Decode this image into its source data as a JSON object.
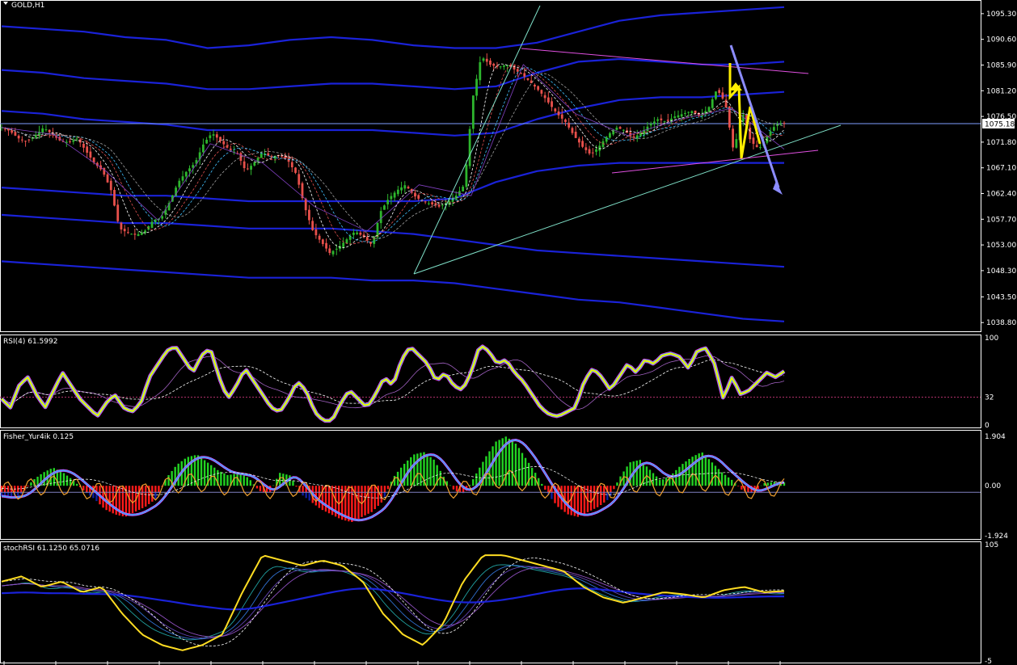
{
  "symbol": "GOLD,H1",
  "colors": {
    "background": "#000000",
    "candle_up": "#2db52d",
    "candle_down": "#e8504b",
    "bands": "#1a22d8",
    "trendline": "#7fe0c8",
    "resistance": "#e050e0",
    "current_price_line": "#7fa0ff",
    "arrow_yellow": "#ffee00",
    "arrow_blue": "#8c8cff",
    "rsi_yellow": "#ffee00",
    "rsi_magenta": "#ff2bd6",
    "rsi_cyan": "#20c8ff",
    "fisher_green": "#22d322",
    "fisher_red": "#ff1a1a",
    "fisher_navy": "#0f1fa0",
    "fisher_orange": "#f0a030",
    "stoch_yellow": "#ffdd22"
  },
  "chart_data": [
    {
      "type": "candlestick",
      "panel": "price",
      "title": "GOLD,H1",
      "current_price": "1075.18",
      "ylim": [
        1037.5,
        1097.5
      ],
      "y_tick_labels": [
        "1095.30",
        "1090.60",
        "1085.90",
        "1081.20",
        "1076.50",
        "1071.80",
        "1067.10",
        "1062.40",
        "1057.70",
        "1053.00",
        "1048.30",
        "1043.50",
        "1038.80"
      ],
      "y_ticks": [
        1095.3,
        1090.6,
        1085.9,
        1081.2,
        1076.5,
        1071.8,
        1067.1,
        1062.4,
        1057.7,
        1053.0,
        1048.3,
        1043.5,
        1038.8
      ],
      "close_path": [
        1074.5,
        1073.8,
        1072.5,
        1071.9,
        1073.0,
        1074.5,
        1073.2,
        1072.0,
        1071.8,
        1072.5,
        1070.2,
        1068.0,
        1066.5,
        1063.0,
        1056.0,
        1055.2,
        1054.8,
        1055.5,
        1057.5,
        1058.0,
        1061.0,
        1064.5,
        1066.5,
        1068.0,
        1071.5,
        1073.5,
        1072.0,
        1070.5,
        1069.8,
        1066.5,
        1068.0,
        1070.0,
        1069.0,
        1069.5,
        1068.5,
        1066.0,
        1060.0,
        1055.5,
        1053.5,
        1051.5,
        1052.5,
        1054.0,
        1055.5,
        1054.5,
        1053.0,
        1059.0,
        1061.5,
        1063.0,
        1064.0,
        1062.0,
        1061.0,
        1060.5,
        1060.0,
        1060.8,
        1062.0,
        1064.0,
        1080.0,
        1087.5,
        1086.0,
        1085.5,
        1086.0,
        1085.0,
        1084.0,
        1082.5,
        1081.0,
        1079.0,
        1077.0,
        1075.5,
        1073.0,
        1071.0,
        1069.5,
        1071.0,
        1073.0,
        1074.5,
        1074.0,
        1072.5,
        1073.5,
        1075.0,
        1076.0,
        1075.5,
        1076.5,
        1077.0,
        1077.5,
        1076.5,
        1078.0,
        1081.5,
        1079.0,
        1070.0,
        1077.5,
        1072.0,
        1070.5,
        1073.0,
        1075.0,
        1075.2
      ],
      "bands_upper": [
        [
          1093.0,
          1092.5,
          1092.0,
          1091.0,
          1090.5,
          1089.0,
          1089.5,
          1090.5,
          1091.0,
          1090.5,
          1089.5,
          1089.0,
          1089.0,
          1090.0,
          1092.0,
          1094.0,
          1095.0,
          1095.5,
          1096.0,
          1096.5
        ],
        [
          1085.0,
          1084.5,
          1083.5,
          1083.0,
          1082.5,
          1081.5,
          1081.5,
          1082.0,
          1082.5,
          1082.5,
          1082.0,
          1081.5,
          1082.0,
          1084.5,
          1086.5,
          1087.0,
          1086.5,
          1086.0,
          1086.0,
          1086.5
        ],
        [
          1077.5,
          1077.0,
          1076.0,
          1075.5,
          1075.0,
          1074.0,
          1074.0,
          1074.0,
          1074.0,
          1074.0,
          1073.5,
          1073.0,
          1073.5,
          1076.0,
          1078.0,
          1079.5,
          1080.0,
          1080.0,
          1080.5,
          1081.0
        ]
      ],
      "bands_lower": [
        [
          1063.5,
          1063.0,
          1062.5,
          1062.0,
          1062.0,
          1061.5,
          1061.0,
          1061.0,
          1061.0,
          1061.0,
          1061.0,
          1061.5,
          1064.5,
          1066.5,
          1067.5,
          1068.0,
          1068.0,
          1068.0,
          1068.0,
          1068.0
        ],
        [
          1058.5,
          1058.0,
          1057.5,
          1057.0,
          1057.0,
          1056.5,
          1056.0,
          1056.0,
          1056.0,
          1055.5,
          1055.0,
          1054.0,
          1053.0,
          1052.0,
          1051.5,
          1051.0,
          1050.5,
          1050.0,
          1049.5,
          1049.0
        ],
        [
          1050.0,
          1049.5,
          1049.0,
          1048.5,
          1048.0,
          1047.5,
          1047.0,
          1047.0,
          1047.0,
          1046.5,
          1046.5,
          1046.0,
          1045.0,
          1044.0,
          1043.0,
          1042.5,
          1041.5,
          1040.5,
          1039.5,
          1039.0
        ]
      ]
    },
    {
      "type": "line",
      "panel": "rsi",
      "title": "RSI(4) 61.5992",
      "ylim": [
        0,
        100
      ],
      "y_tick_labels": [
        "100",
        "32",
        "0"
      ],
      "y_ticks": [
        100,
        32,
        0
      ],
      "reference_level": 32,
      "values": [
        30,
        20,
        45,
        55,
        35,
        20,
        40,
        60,
        45,
        30,
        20,
        10,
        25,
        35,
        20,
        15,
        25,
        55,
        70,
        85,
        90,
        75,
        60,
        80,
        88,
        55,
        30,
        45,
        65,
        50,
        35,
        20,
        15,
        30,
        50,
        40,
        15,
        5,
        5,
        25,
        40,
        30,
        20,
        35,
        55,
        45,
        75,
        90,
        80,
        70,
        50,
        60,
        45,
        40,
        60,
        92,
        85,
        70,
        75,
        60,
        50,
        35,
        20,
        12,
        10,
        15,
        20,
        50,
        65,
        55,
        40,
        55,
        70,
        60,
        75,
        70,
        80,
        82,
        78,
        65,
        85,
        88,
        70,
        30,
        55,
        35,
        40,
        50,
        60,
        55,
        61.6
      ]
    },
    {
      "type": "bar",
      "panel": "fisher",
      "title": "Fisher_Yur4ik 0.125",
      "ylim": [
        -1.924,
        1.904
      ],
      "y_tick_labels": [
        "1.904",
        "0.00",
        "-1.924"
      ],
      "y_ticks": [
        1.904,
        0.0,
        -1.924
      ],
      "values": [
        -0.4,
        -0.5,
        -0.3,
        0.2,
        0.5,
        0.7,
        0.5,
        0.2,
        -0.2,
        -0.5,
        -0.9,
        -1.1,
        -1.2,
        -1.0,
        -0.8,
        -0.5,
        0.3,
        0.8,
        1.1,
        1.2,
        0.9,
        0.6,
        0.4,
        0.5,
        0.3,
        -0.2,
        -0.3,
        0.5,
        0.4,
        -0.3,
        -0.6,
        -0.9,
        -1.1,
        -1.3,
        -1.4,
        -1.2,
        -1.0,
        -0.6,
        0.3,
        0.8,
        1.2,
        1.3,
        1.0,
        0.3,
        -0.2,
        -0.3,
        0.4,
        1.1,
        1.7,
        1.9,
        1.6,
        1.0,
        0.4,
        -0.3,
        -0.8,
        -1.1,
        -1.2,
        -1.0,
        -0.8,
        -0.5,
        0.3,
        0.9,
        1.0,
        0.6,
        0.2,
        0.4,
        0.8,
        1.1,
        1.3,
        0.9,
        0.5,
        0.2,
        -0.2,
        -0.3,
        0.1,
        0.15,
        0.125
      ]
    },
    {
      "type": "line",
      "panel": "stochrsi",
      "title": "stochRSI 61.1250 65.0716",
      "ylim": [
        -5,
        105
      ],
      "y_tick_labels": [
        "105",
        "-5"
      ],
      "y_ticks": [
        105,
        -5
      ],
      "values": [
        70,
        75,
        65,
        70,
        60,
        65,
        40,
        20,
        10,
        5,
        10,
        20,
        60,
        95,
        90,
        85,
        90,
        85,
        70,
        40,
        20,
        10,
        30,
        70,
        95,
        95,
        90,
        85,
        80,
        65,
        55,
        50,
        55,
        60,
        58,
        55,
        62,
        65,
        60,
        61.1
      ]
    }
  ],
  "x_axis_ticks_count": 16
}
